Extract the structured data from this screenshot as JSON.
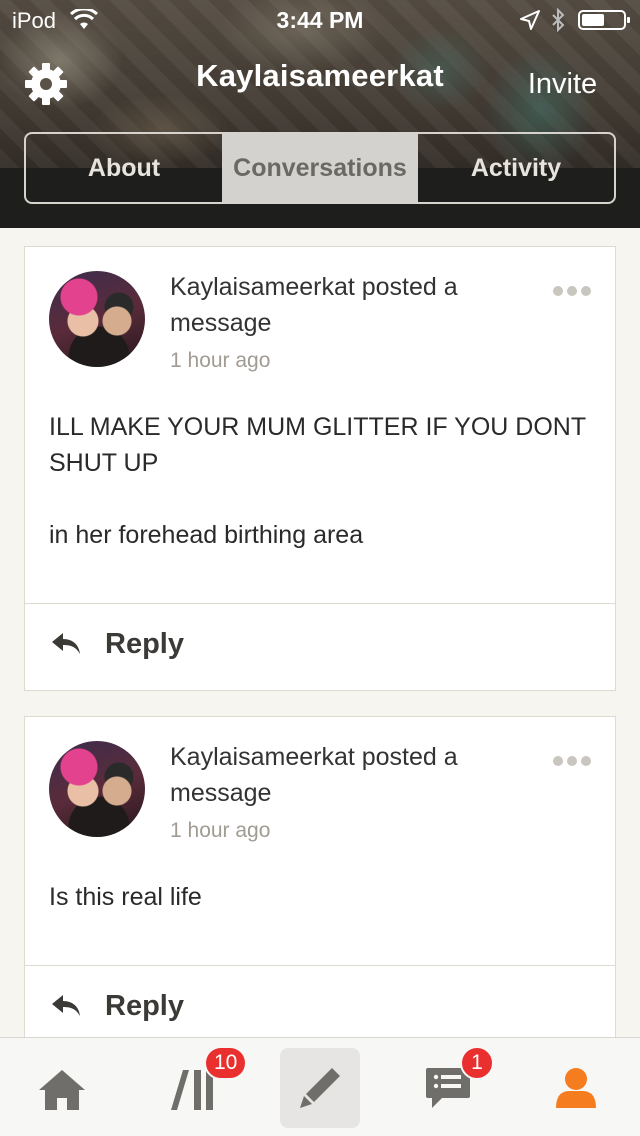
{
  "status_bar": {
    "carrier": "iPod",
    "time": "3:44 PM"
  },
  "header": {
    "title": "Kaylaisameerkat",
    "invite_label": "Invite",
    "tabs": [
      {
        "label": "About",
        "active": false
      },
      {
        "label": "Conversations",
        "active": true
      },
      {
        "label": "Activity",
        "active": false
      }
    ]
  },
  "posts": [
    {
      "author_line": "Kaylaisameerkat posted a message",
      "time": "1 hour ago",
      "body": "ILL MAKE YOUR MUM GLITTER IF YOU DONT SHUT UP\n\nin her forehead birthing area",
      "reply_label": "Reply"
    },
    {
      "author_line": "Kaylaisameerkat posted a message",
      "time": "1 hour ago",
      "body": "Is this real life",
      "reply_label": "Reply"
    }
  ],
  "tab_bar": {
    "items": [
      {
        "icon": "home-icon"
      },
      {
        "icon": "library-icon",
        "badge": "10"
      },
      {
        "icon": "pencil-icon",
        "active": true
      },
      {
        "icon": "messages-icon",
        "badge": "1"
      },
      {
        "icon": "profile-icon"
      }
    ],
    "accent_color": "#f57c1f"
  },
  "colors": {
    "badge": "#e9302f",
    "active_segment": "#d3d2ce"
  }
}
